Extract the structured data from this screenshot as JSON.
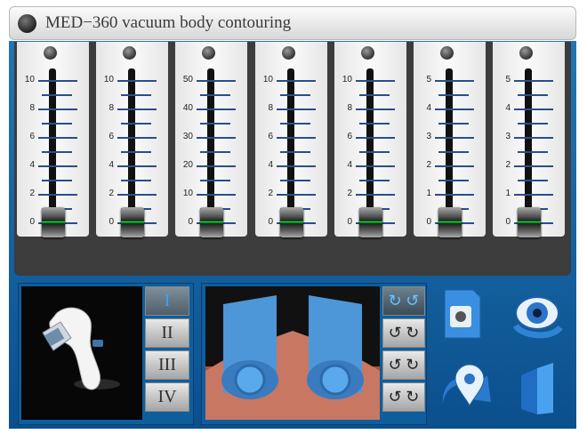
{
  "title": "MED−360 vacuum body contouring",
  "faders": [
    {
      "labels": [
        "10",
        "8",
        "6",
        "4",
        "2",
        "0"
      ],
      "value": 0
    },
    {
      "labels": [
        "10",
        "8",
        "6",
        "4",
        "2",
        "0"
      ],
      "value": 0
    },
    {
      "labels": [
        "50",
        "40",
        "30",
        "20",
        "10",
        "0"
      ],
      "value": 0
    },
    {
      "labels": [
        "10",
        "8",
        "6",
        "4",
        "2",
        "0"
      ],
      "value": 0
    },
    {
      "labels": [
        "10",
        "8",
        "6",
        "4",
        "2",
        "0"
      ],
      "value": 0
    },
    {
      "labels": [
        "5",
        "4",
        "3",
        "2",
        "1",
        "0"
      ],
      "value": 0
    },
    {
      "labels": [
        "5",
        "4",
        "3",
        "2",
        "1",
        "0"
      ],
      "value": 0
    }
  ],
  "levels": [
    {
      "label": "I",
      "active": true
    },
    {
      "label": "II",
      "active": false
    },
    {
      "label": "III",
      "active": false
    },
    {
      "label": "IV",
      "active": false
    }
  ],
  "modes": [
    {
      "label": "↻ ↺",
      "active": true
    },
    {
      "label": "↺ ↻",
      "active": false
    },
    {
      "label": "↺ ↻",
      "active": false
    },
    {
      "label": "↺ ↻",
      "active": false
    }
  ],
  "actions": [
    "save-icon",
    "eye-refresh-icon",
    "location-icon",
    "building-icon"
  ],
  "colors": {
    "panel_blue": "#0e5e9e",
    "accent_blue": "#3aa0ff",
    "handle_green": "#00ff33"
  }
}
